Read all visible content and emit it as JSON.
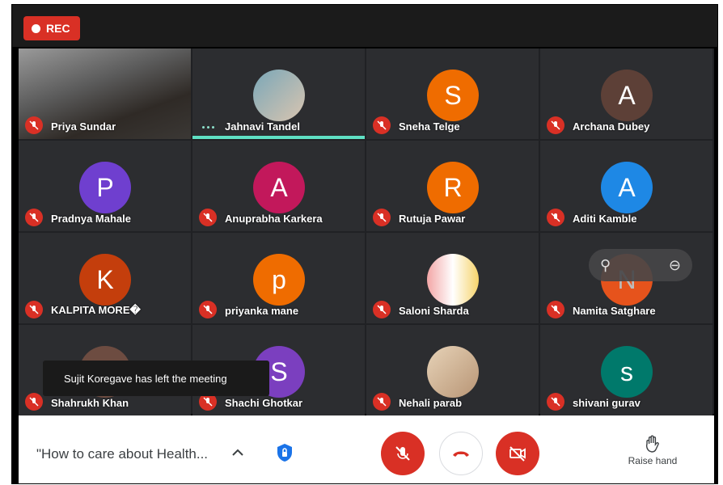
{
  "rec_label": "REC",
  "toast": "Sujit Koregave has left the meeting",
  "meeting_title": "\"How to care about Health...",
  "raise_hand_label": "Raise hand",
  "colors": {
    "red": "#d93025",
    "accent_teal": "#5fe0c4"
  },
  "participants": [
    {
      "name": "Priya Sundar",
      "initial": "",
      "color": "",
      "type": "video"
    },
    {
      "name": "Jahnavi Tandel",
      "initial": "",
      "color": "",
      "type": "photo"
    },
    {
      "name": "Sneha Telge",
      "initial": "S",
      "color": "#ef6c00"
    },
    {
      "name": "Archana Dubey",
      "initial": "A",
      "color": "#5d4037"
    },
    {
      "name": "Pradnya Mahale",
      "initial": "P",
      "color": "#6f3fcf"
    },
    {
      "name": "Anuprabha Karkera",
      "initial": "A",
      "color": "#c2185b"
    },
    {
      "name": "Rutuja Pawar",
      "initial": "R",
      "color": "#ef6c00"
    },
    {
      "name": "Aditi Kamble",
      "initial": "A",
      "color": "#1e88e5"
    },
    {
      "name": "KALPITA MORE�",
      "initial": "K",
      "color": "#c43e0c"
    },
    {
      "name": "priyanka mane",
      "initial": "p",
      "color": "#ef6c00"
    },
    {
      "name": "Saloni Sharda",
      "initial": "",
      "color": "",
      "type": "photo"
    },
    {
      "name": "Namita Satghare",
      "initial": "N",
      "color": "#e6531c"
    },
    {
      "name": "Shahrukh Khan",
      "initial": "",
      "color": "#6d4c41"
    },
    {
      "name": "Shachi Ghotkar",
      "initial": "S",
      "color": "#7b3fbf"
    },
    {
      "name": "Nehali parab",
      "initial": "",
      "color": "",
      "type": "photo"
    },
    {
      "name": "shivani gurav",
      "initial": "s",
      "color": "#00796b"
    }
  ]
}
